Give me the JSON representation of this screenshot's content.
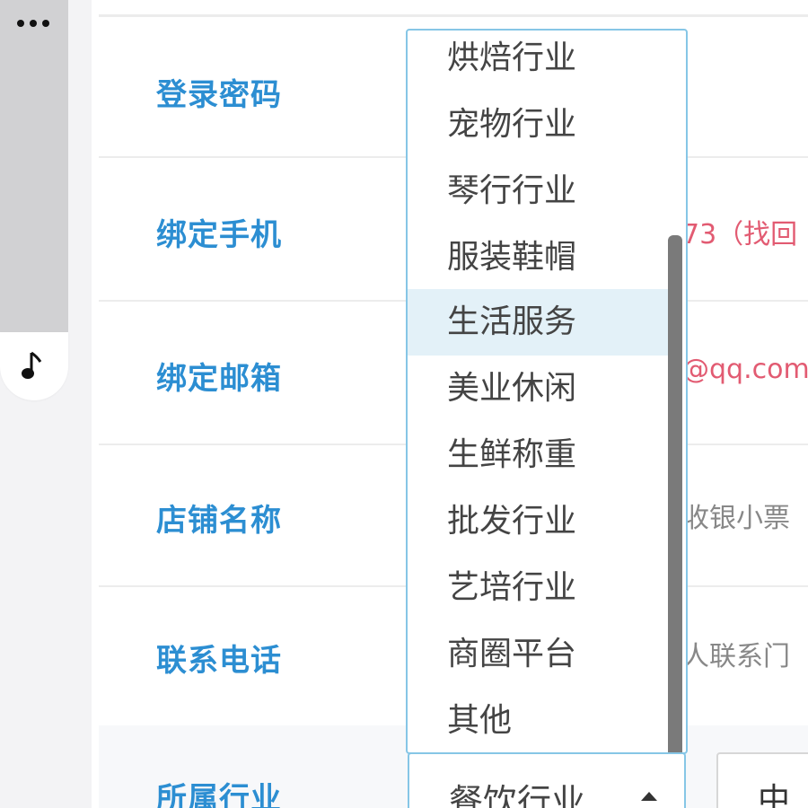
{
  "sidebar": {
    "icons": [
      "more-icon",
      "music-note-icon"
    ]
  },
  "form": {
    "rows": [
      {
        "label": "登录密码",
        "value": ""
      },
      {
        "label": "绑定手机",
        "value": "73（找回"
      },
      {
        "label": "绑定邮箱",
        "value": "@qq.com"
      },
      {
        "label": "店铺名称",
        "value": "收银小票"
      },
      {
        "label": "联系电话",
        "value": "人联系门"
      },
      {
        "label": "所属行业",
        "value": ""
      }
    ]
  },
  "industry_select": {
    "selected": "餐饮行业",
    "next_field_partial": "中\u0000"
  },
  "dropdown": {
    "options": [
      "烘焙行业",
      "宠物行业",
      "琴行行业",
      "服装鞋帽",
      "生活服务",
      "美业休闲",
      "生鲜称重",
      "批发行业",
      "艺培行业",
      "商圈平台",
      "其他"
    ],
    "highlighted": "生活服务",
    "scroll_position": 0.72
  },
  "colors": {
    "label": "#2c8ed2",
    "accent_border": "#86c6e6",
    "highlight": "#e3f1f8",
    "red_text": "#e25b72"
  }
}
